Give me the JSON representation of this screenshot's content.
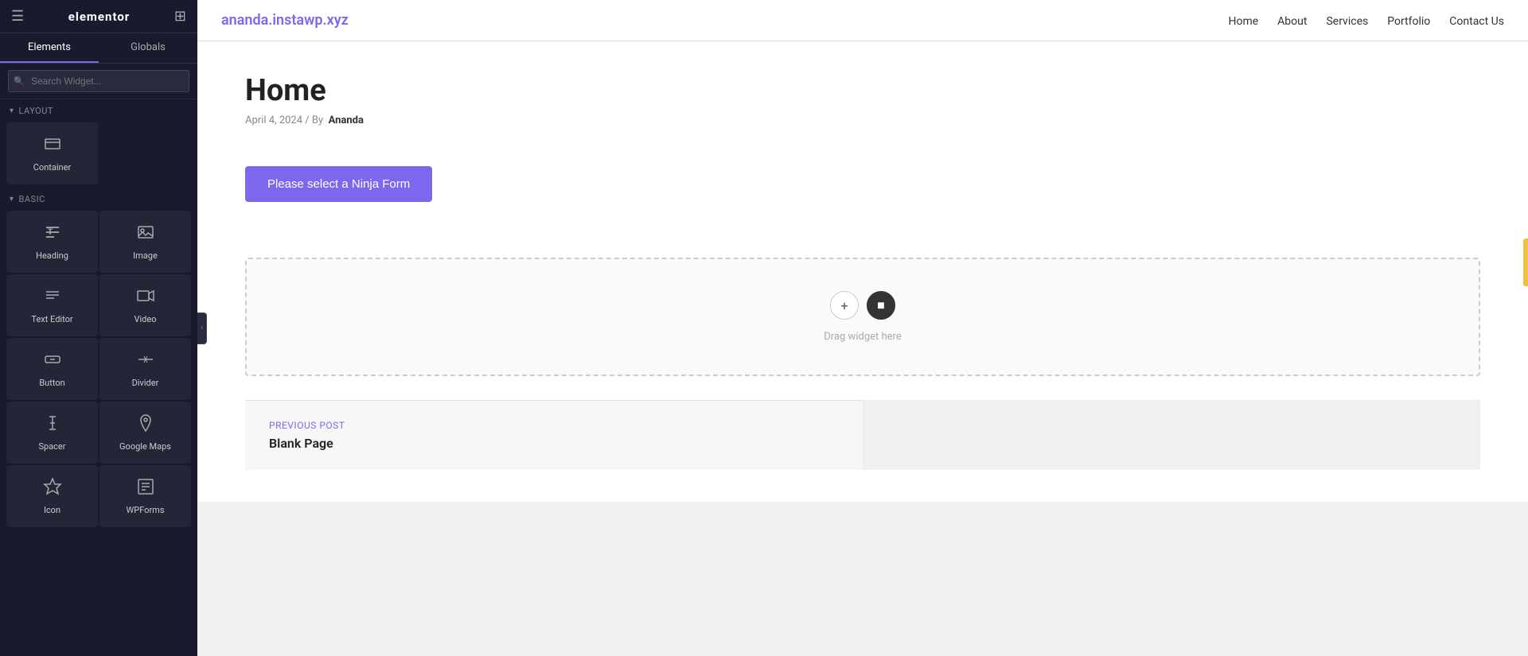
{
  "sidebar": {
    "logo": "elementor",
    "tabs": [
      {
        "label": "Elements",
        "active": true
      },
      {
        "label": "Globals",
        "active": false
      }
    ],
    "search": {
      "placeholder": "Search Widget..."
    },
    "sections": [
      {
        "label": "Layout",
        "widgets": [
          {
            "name": "container",
            "label": "Container",
            "icon": "container-icon"
          }
        ]
      },
      {
        "label": "Basic",
        "widgets": [
          {
            "name": "heading",
            "label": "Heading",
            "icon": "heading-icon"
          },
          {
            "name": "image",
            "label": "Image",
            "icon": "image-icon"
          },
          {
            "name": "text-editor",
            "label": "Text Editor",
            "icon": "text-editor-icon"
          },
          {
            "name": "video",
            "label": "Video",
            "icon": "video-icon"
          },
          {
            "name": "button",
            "label": "Button",
            "icon": "button-icon"
          },
          {
            "name": "divider",
            "label": "Divider",
            "icon": "divider-icon"
          },
          {
            "name": "spacer",
            "label": "Spacer",
            "icon": "spacer-icon"
          },
          {
            "name": "google-maps",
            "label": "Google Maps",
            "icon": "google-maps-icon"
          },
          {
            "name": "icon",
            "label": "Icon",
            "icon": "icon-icon"
          },
          {
            "name": "wpforms",
            "label": "WPForms",
            "icon": "wpforms-icon"
          }
        ]
      }
    ]
  },
  "topnav": {
    "site_title": "ananda.instawp.xyz",
    "nav_links": [
      {
        "label": "Home",
        "href": "#"
      },
      {
        "label": "About",
        "href": "#"
      },
      {
        "label": "Services",
        "href": "#"
      },
      {
        "label": "Portfolio",
        "href": "#"
      },
      {
        "label": "Contact Us",
        "href": "#"
      }
    ]
  },
  "page": {
    "title": "Home",
    "meta_date": "April 4, 2024",
    "meta_by": "By",
    "meta_author": "Ananda",
    "ninja_form_btn": "Please select a Ninja Form",
    "drop_zone_text": "Drag widget here"
  },
  "post_nav": {
    "label": "PREVIOUS POST",
    "title": "Blank Page"
  }
}
